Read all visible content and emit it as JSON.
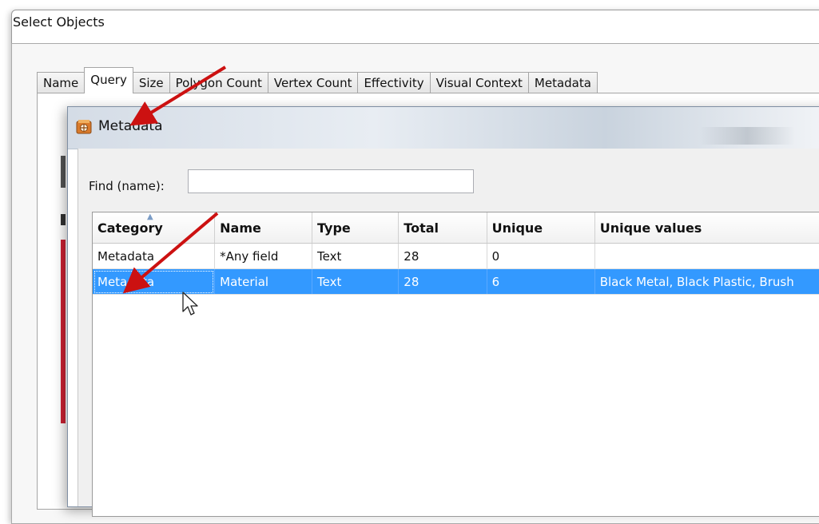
{
  "outer_window": {
    "title": "Select Objects",
    "tabs": [
      {
        "label": "Name"
      },
      {
        "label": "Query",
        "active": true
      },
      {
        "label": "Size"
      },
      {
        "label": "Polygon Count"
      },
      {
        "label": "Vertex Count"
      },
      {
        "label": "Effectivity"
      },
      {
        "label": "Visual Context"
      },
      {
        "label": "Metadata"
      }
    ]
  },
  "dialog": {
    "title": "Metadata",
    "icon": "metadata-app-icon",
    "find_label": "Find (name):",
    "find_value": "",
    "columns": [
      "Category",
      "Name",
      "Type",
      "Total",
      "Unique",
      "Unique values"
    ],
    "sorted_column": "Category",
    "rows": [
      {
        "category": "Metadata",
        "name": "*Any field",
        "type": "Text",
        "total": "28",
        "unique": "0",
        "unique_values": ""
      },
      {
        "category": "Metadata",
        "name": "Material",
        "type": "Text",
        "total": "28",
        "unique": "6",
        "unique_values": "Black Metal, Black Plastic, Brush",
        "selected": true
      }
    ]
  },
  "annotations": {
    "arrow_color": "#cc1111",
    "cursor": "mouse-pointer-icon"
  },
  "colors": {
    "selection": "#3399ff",
    "arrow": "#cc1111"
  }
}
